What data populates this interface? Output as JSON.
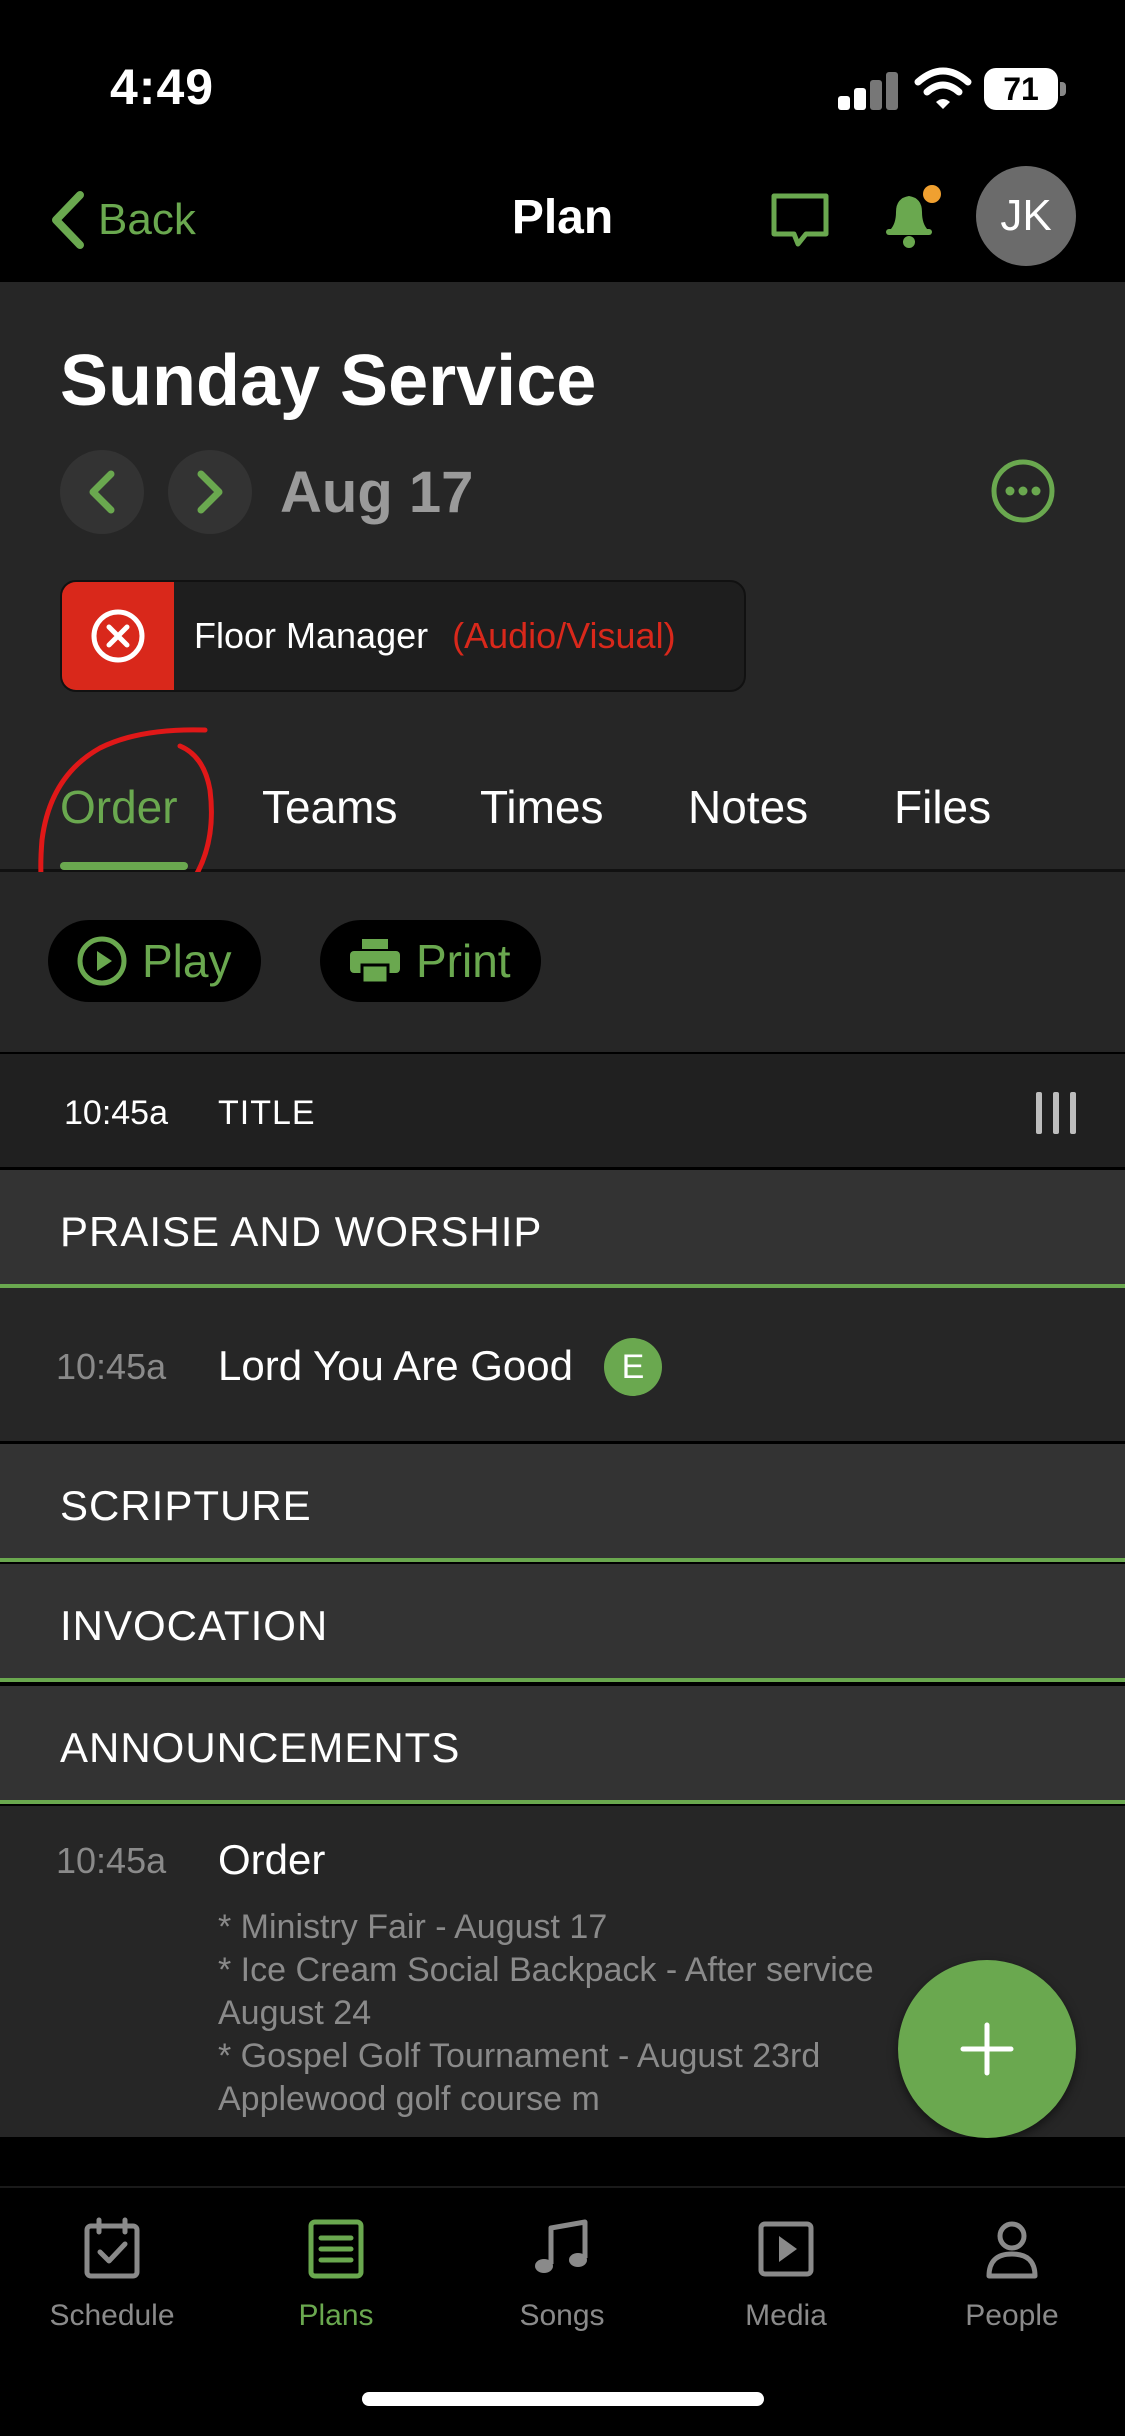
{
  "status_bar": {
    "time": "4:49",
    "battery": "71"
  },
  "nav": {
    "back_label": "Back",
    "title": "Plan",
    "avatar_initials": "JK"
  },
  "plan": {
    "title": "Sunday Service",
    "date": "Aug 17"
  },
  "role": {
    "name": "Floor Manager",
    "team": "(Audio/Visual)"
  },
  "tabs": [
    {
      "label": "Order",
      "active": true
    },
    {
      "label": "Teams"
    },
    {
      "label": "Times"
    },
    {
      "label": "Notes"
    },
    {
      "label": "Files"
    }
  ],
  "actions": {
    "play": "Play",
    "print": "Print"
  },
  "order": {
    "title_row": {
      "time": "10:45a",
      "label": "TITLE"
    },
    "sections": [
      {
        "label": "PRAISE AND WORSHIP"
      },
      {
        "label": "SCRIPTURE"
      },
      {
        "label": "INVOCATION"
      },
      {
        "label": "ANNOUNCEMENTS"
      }
    ],
    "song_item": {
      "time": "10:45a",
      "name": "Lord You Are Good",
      "key": "E"
    },
    "announcement_item": {
      "time": "10:45a",
      "name": "Order",
      "notes": [
        "* Ministry Fair - August 17",
        "* Ice Cream Social Backpack - After service",
        "August 24",
        "* Gospel Golf Tournament - August 23rd",
        "Applewood golf course m"
      ]
    }
  },
  "tabbar": [
    {
      "label": "Schedule",
      "icon": "calendar-check-icon"
    },
    {
      "label": "Plans",
      "icon": "plans-list-icon",
      "active": true
    },
    {
      "label": "Songs",
      "icon": "music-note-icon"
    },
    {
      "label": "Media",
      "icon": "play-box-icon"
    },
    {
      "label": "People",
      "icon": "person-icon"
    }
  ],
  "colors": {
    "accent": "#6aa84f",
    "alert": "#d9281b",
    "notification_dot": "#f0a030"
  }
}
